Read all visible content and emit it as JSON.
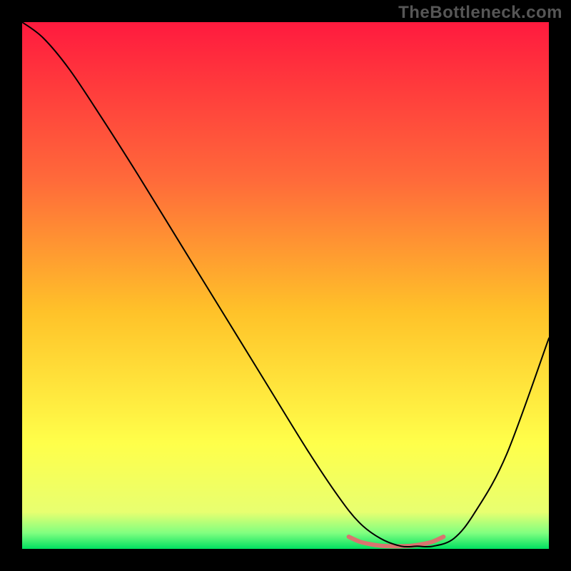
{
  "watermark": "TheBottleneck.com",
  "chart_data": {
    "type": "line",
    "title": "",
    "xlabel": "",
    "ylabel": "",
    "xlim": [
      0,
      100
    ],
    "ylim": [
      0,
      100
    ],
    "background_gradient_stops": [
      {
        "offset": 0.0,
        "color": "#ff1a3e"
      },
      {
        "offset": 0.3,
        "color": "#ff6a3a"
      },
      {
        "offset": 0.55,
        "color": "#ffc229"
      },
      {
        "offset": 0.8,
        "color": "#ffff4a"
      },
      {
        "offset": 0.93,
        "color": "#e8ff70"
      },
      {
        "offset": 0.97,
        "color": "#80ff80"
      },
      {
        "offset": 1.0,
        "color": "#00e060"
      }
    ],
    "series": [
      {
        "name": "bottleneck-curve",
        "color": "#000000",
        "width": 2,
        "x": [
          0,
          4,
          9,
          15,
          22,
          30,
          38,
          46,
          54,
          60,
          64,
          68,
          72,
          75,
          78,
          82,
          86,
          92,
          100
        ],
        "y": [
          100,
          97,
          91,
          82,
          71,
          58,
          45,
          32,
          19,
          10,
          5,
          2,
          0.5,
          0.5,
          0.5,
          2,
          7,
          18,
          40
        ]
      }
    ],
    "flat_marker": {
      "name": "minimum-band",
      "color": "#d9746f",
      "width": 6,
      "x": [
        62,
        64,
        66,
        68,
        70,
        72,
        74,
        76,
        78,
        80
      ],
      "y": [
        2.3,
        1.4,
        0.9,
        0.6,
        0.5,
        0.5,
        0.6,
        0.9,
        1.4,
        2.3
      ]
    }
  }
}
